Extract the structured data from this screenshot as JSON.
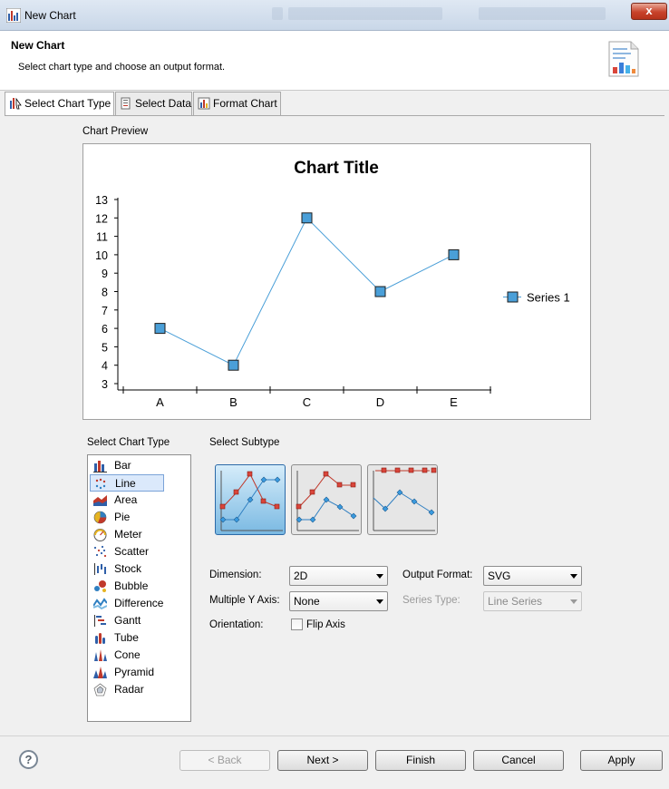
{
  "window": {
    "title": "New Chart",
    "close_label": "x"
  },
  "header": {
    "title": "New Chart",
    "subtitle": "Select chart type and choose an output format.",
    "icon": "wizard-chart-icon"
  },
  "tabs": [
    {
      "label": "Select Chart Type",
      "icon": "chart-type-icon",
      "active": true
    },
    {
      "label": "Select Data",
      "icon": "data-icon",
      "active": false
    },
    {
      "label": "Format Chart",
      "icon": "format-chart-icon",
      "active": false
    }
  ],
  "preview": {
    "label": "Chart Preview"
  },
  "chart_data": {
    "type": "line",
    "title": "Chart Title",
    "categories": [
      "A",
      "B",
      "C",
      "D",
      "E"
    ],
    "series": [
      {
        "name": "Series 1",
        "values": [
          6,
          4,
          12,
          8,
          10
        ],
        "color": "#4a9fd8"
      }
    ],
    "ylim": [
      3,
      13
    ],
    "yticks": [
      3,
      4,
      5,
      6,
      7,
      8,
      9,
      10,
      11,
      12,
      13
    ],
    "legend_position": "right",
    "grid": false
  },
  "chart_types": {
    "label": "Select Chart Type",
    "selected": "Line",
    "items": [
      {
        "label": "Bar",
        "icon": "bar-chart-icon"
      },
      {
        "label": "Line",
        "icon": "line-chart-icon"
      },
      {
        "label": "Area",
        "icon": "area-chart-icon"
      },
      {
        "label": "Pie",
        "icon": "pie-chart-icon"
      },
      {
        "label": "Meter",
        "icon": "meter-chart-icon"
      },
      {
        "label": "Scatter",
        "icon": "scatter-chart-icon"
      },
      {
        "label": "Stock",
        "icon": "stock-chart-icon"
      },
      {
        "label": "Bubble",
        "icon": "bubble-chart-icon"
      },
      {
        "label": "Difference",
        "icon": "difference-chart-icon"
      },
      {
        "label": "Gantt",
        "icon": "gantt-chart-icon"
      },
      {
        "label": "Tube",
        "icon": "tube-chart-icon"
      },
      {
        "label": "Cone",
        "icon": "cone-chart-icon"
      },
      {
        "label": "Pyramid",
        "icon": "pyramid-chart-icon"
      },
      {
        "label": "Radar",
        "icon": "radar-chart-icon"
      }
    ]
  },
  "subtypes": {
    "label": "Select Subtype",
    "selected_index": 0
  },
  "options": {
    "dimension_label": "Dimension:",
    "dimension_value": "2D",
    "multiple_y_label": "Multiple Y Axis:",
    "multiple_y_value": "None",
    "orientation_label": "Orientation:",
    "flip_axis_label": "Flip Axis",
    "flip_axis_checked": false,
    "output_format_label": "Output Format:",
    "output_format_value": "SVG",
    "series_type_label": "Series Type:",
    "series_type_value": "Line Series"
  },
  "buttons": {
    "help": "?",
    "back": "< Back",
    "next": "Next >",
    "finish": "Finish",
    "cancel": "Cancel",
    "apply": "Apply"
  }
}
